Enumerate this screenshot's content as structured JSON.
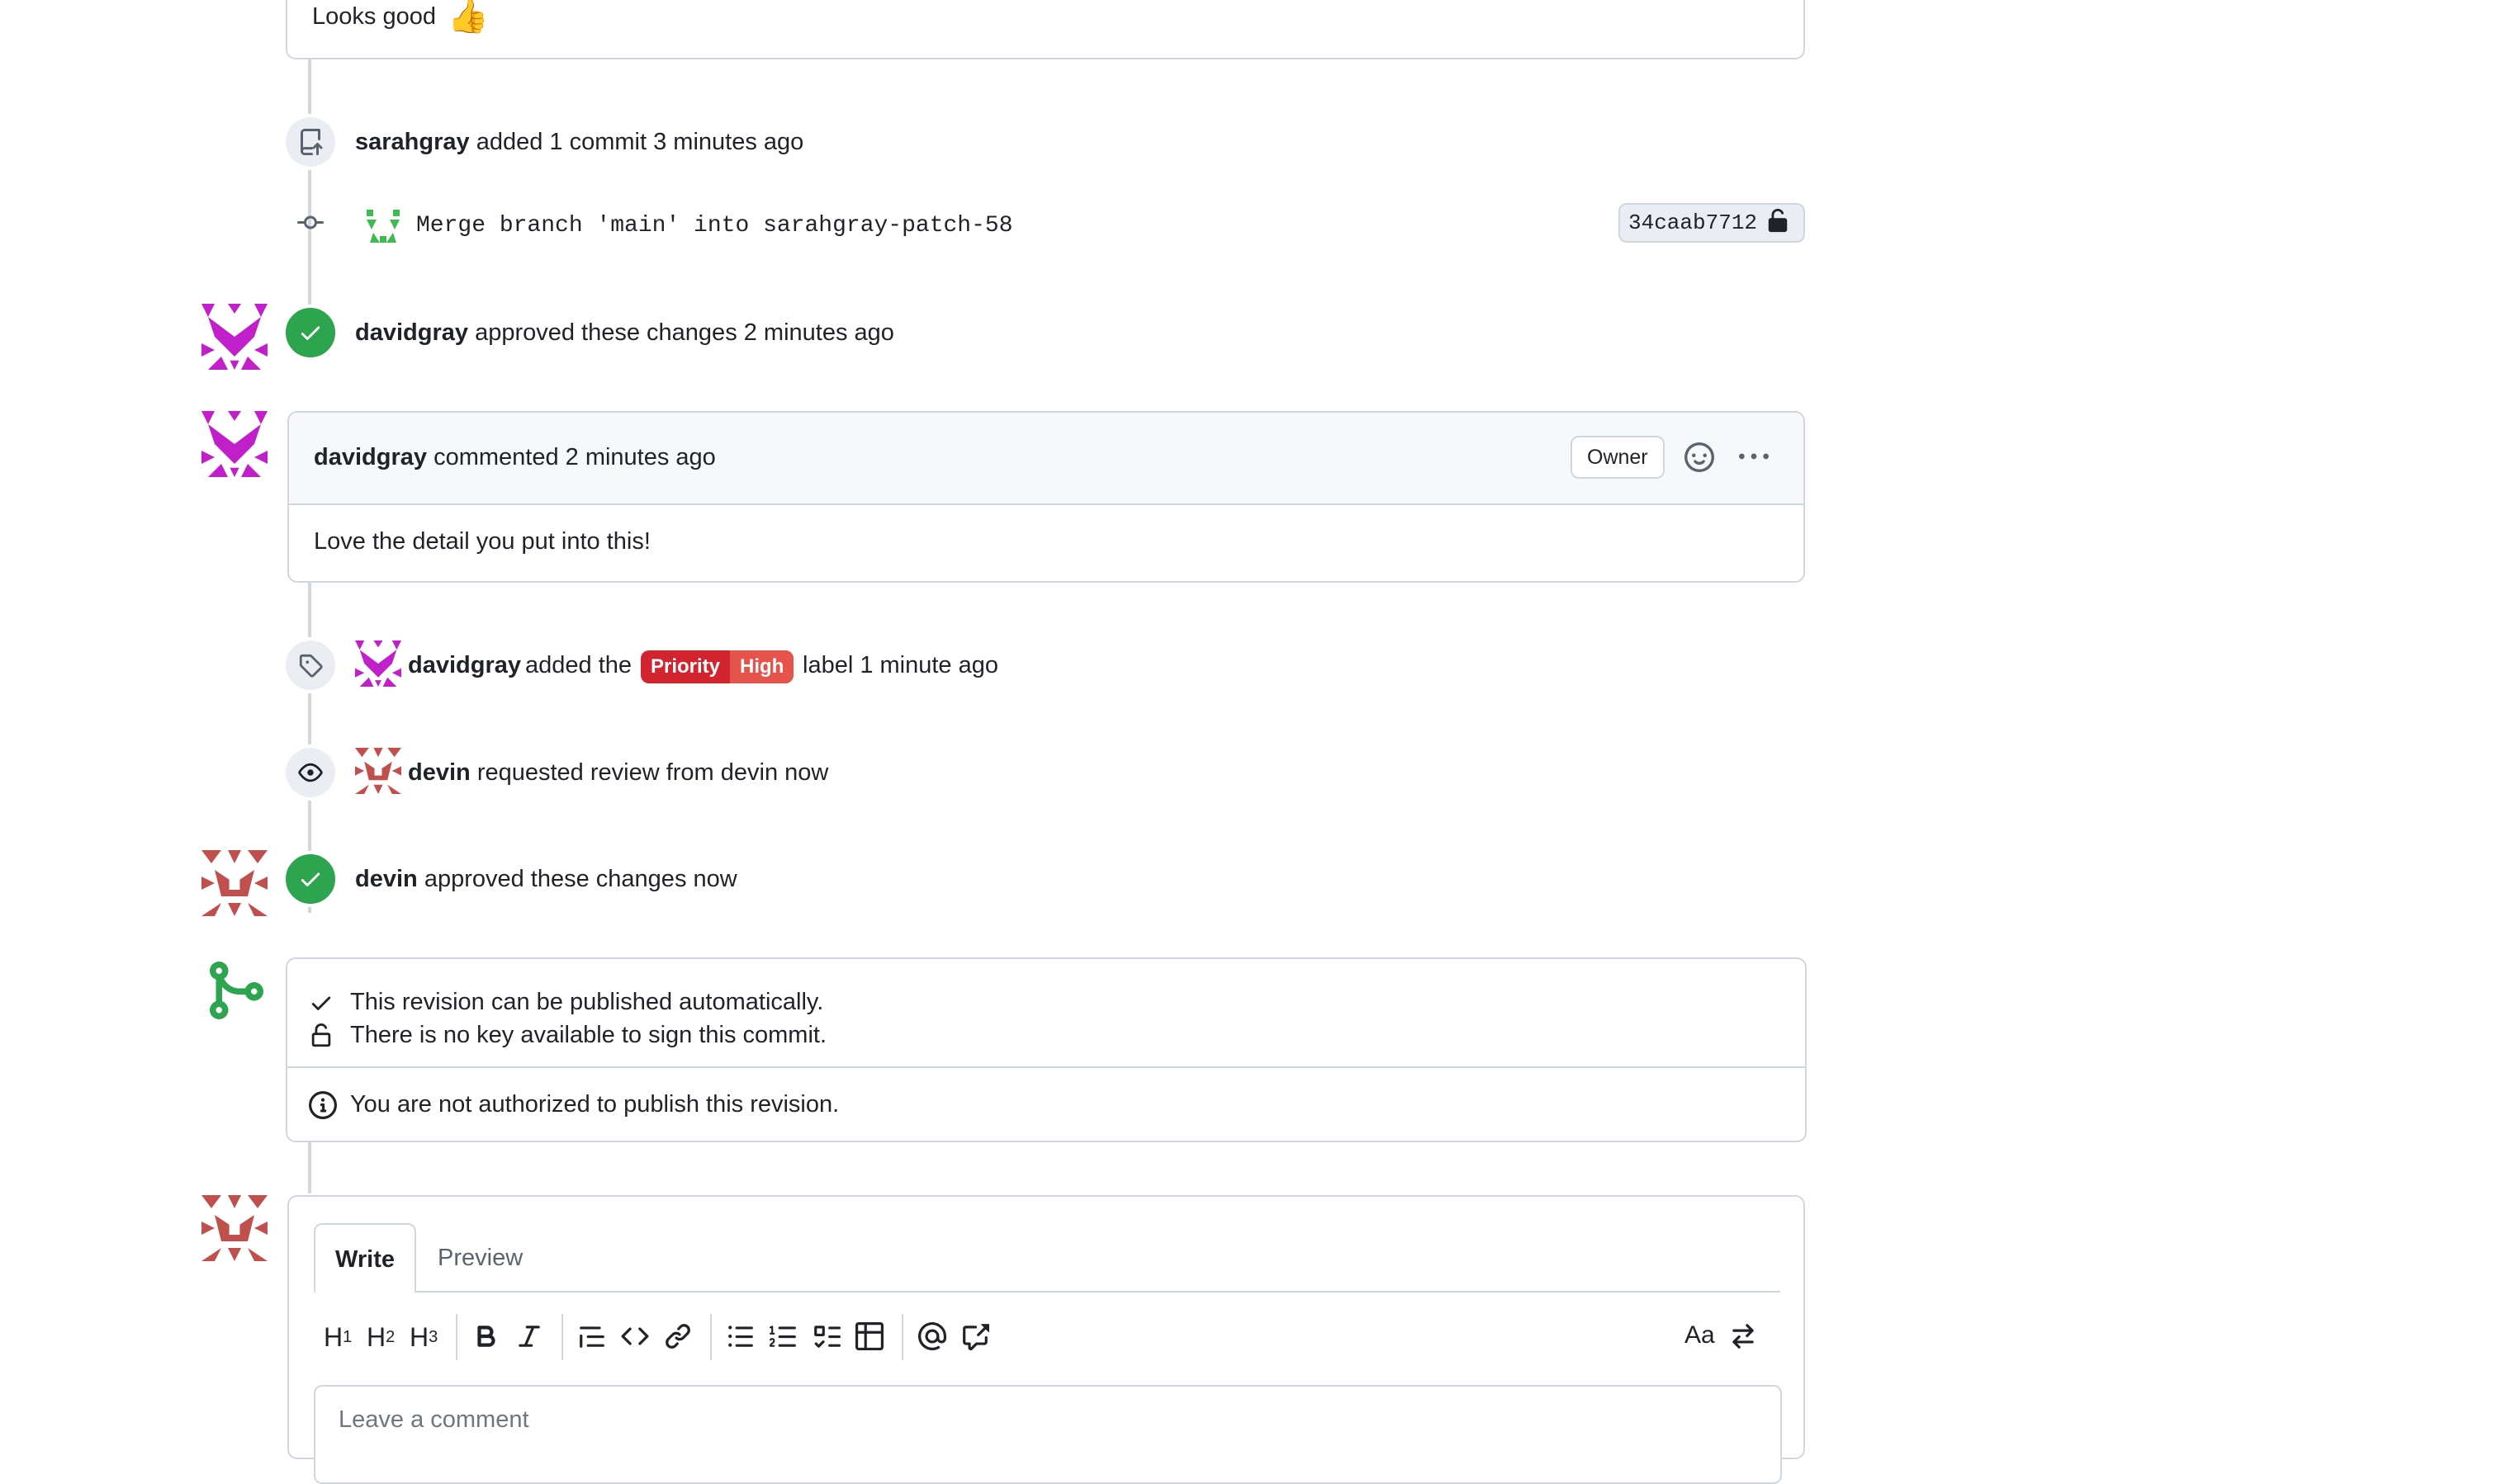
{
  "top_comment": {
    "text": "Looks good",
    "emoji": "👍"
  },
  "event_commit_added": {
    "user": "sarahgray",
    "text": "added 1 commit 3 minutes ago"
  },
  "commit": {
    "message": "Merge branch 'main' into sarahgray-patch-58",
    "sha": "34caab7712"
  },
  "event_approved_1": {
    "user": "davidgray",
    "text": "approved these changes 2 minutes ago"
  },
  "comment": {
    "user": "davidgray",
    "meta": "commented 2 minutes ago",
    "role_badge": "Owner",
    "body": "Love the detail you put into this!"
  },
  "event_label": {
    "user": "davidgray",
    "text_before": "added the",
    "label_scope": "Priority",
    "label_value": "High",
    "text_after": "label 1 minute ago"
  },
  "event_review_request": {
    "user": "devin",
    "text": "requested review from devin now"
  },
  "event_approved_2": {
    "user": "devin",
    "text": "approved these changes now"
  },
  "merge_box": {
    "check_1": "This revision can be published automatically.",
    "check_2": "There is no key available to sign this commit.",
    "notice": "You are not authorized to publish this revision."
  },
  "editor": {
    "tab_write": "Write",
    "tab_preview": "Preview",
    "toolbar": {
      "h1": "H",
      "h1_sub": "1",
      "h2": "H",
      "h2_sub": "2",
      "h3": "H",
      "h3_sub": "3",
      "font_toggle": "Aa"
    },
    "placeholder": "Leave a comment"
  },
  "colors": {
    "green": "#2da44e",
    "label_bg": "#d1242f",
    "avatar_purple": "#c11fc9",
    "avatar_rose": "#c0504d"
  }
}
